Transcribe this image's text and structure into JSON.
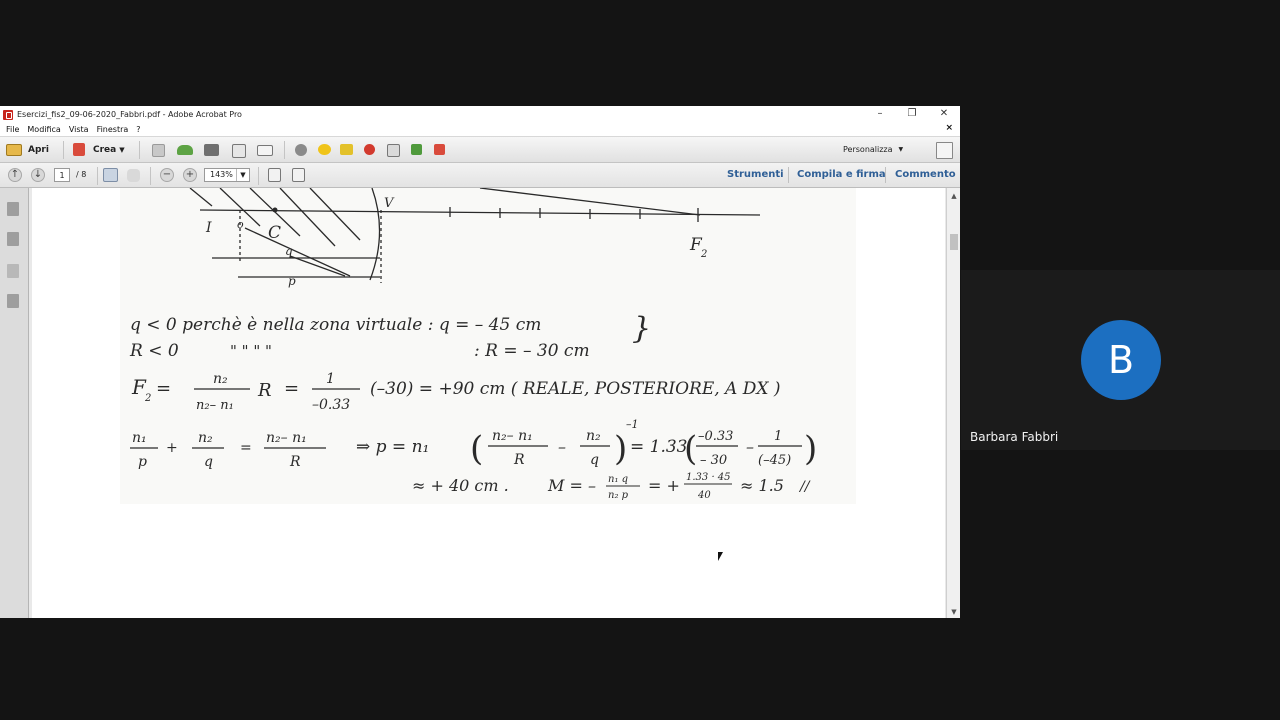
{
  "window": {
    "title": "Esercizi_fis2_09-06-2020_Fabbri.pdf - Adobe Acrobat Pro",
    "minimize_glyph": "–",
    "restore_glyph": "❐",
    "close_glyph": "✕"
  },
  "menu": {
    "items": [
      "File",
      "Modifica",
      "Vista",
      "Finestra",
      "?"
    ],
    "close_doc_glyph": "×"
  },
  "toolbar": {
    "open_label": "Apri",
    "create_label": "Crea",
    "customize_label": "Personalizza"
  },
  "nav": {
    "page_current": "1",
    "page_total": "/ 8",
    "zoom": "143%",
    "tools_label": "Strumenti",
    "fill_sign_label": "Compila e firma",
    "comment_label": "Commento"
  },
  "document": {
    "diagram": {
      "label_v": "V",
      "label_i": "I",
      "label_o": "o",
      "label_c": "C",
      "label_q": "q",
      "label_p": "p",
      "label_f": "F",
      "label_f_sub": "2"
    },
    "line1": "q < 0  perchè è nella zona virtuale  :  q = – 45 cm",
    "line2_left": "R < 0",
    "line2_ditto": "\"       \"       \"      \"",
    "line2_right": ":  R = – 30 cm",
    "line3_f": "F",
    "line3_f_sub": "2",
    "line3_num": "n₂",
    "line3_den": "n₂– n₁",
    "line3_r": "R",
    "line3_num2": "1",
    "line3_den2": "–0.33",
    "line3_rest": "(–30)  =  +90 cm  ( REALE, POSTERIORE, A DX )",
    "line4_n1": "n₁",
    "line4_p": "p",
    "line4_n2": "n₂",
    "line4_q": "q",
    "line4_diff": "n₂– n₁",
    "line4_r": "R",
    "line4_mid": "⇒   p  =  n₁",
    "line4_val": "= 1.33",
    "line4_frac1_num": "–0.33",
    "line4_frac1_den": "– 30",
    "line4_frac2_num": "1",
    "line4_frac2_den": "(–45)",
    "line4_exp": "–1",
    "line5_left": "≈ + 40 cm  .",
    "line5_m": "M = –",
    "line5_num": "n₁  q",
    "line5_den": "n₂  p",
    "line5_eq": "= +",
    "line5_num2": "1.33 · 45",
    "line5_den2": "40",
    "line5_res": "≈ 1.5"
  },
  "participant": {
    "initial": "B",
    "name": "Barbara Fabbri"
  },
  "colors": {
    "acrobat_red": "#c8241c",
    "link_blue": "#2f5f96",
    "avatar_blue": "#1c6fc1",
    "ink": "#2a2a2a"
  }
}
